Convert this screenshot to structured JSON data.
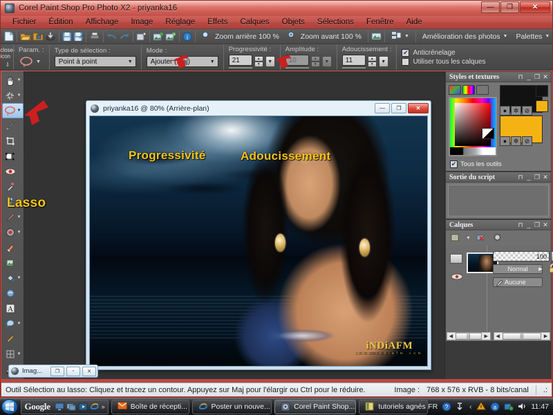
{
  "window": {
    "title": "Corel Paint Shop Pro Photo X2 - priyanka16",
    "icon": "application-icon",
    "buttons": {
      "minimize": "—",
      "maximize": "❐",
      "close": "✕"
    }
  },
  "menubar": {
    "items": [
      "Fichier",
      "Édition",
      "Affichage",
      "Image",
      "Réglage",
      "Effets",
      "Calques",
      "Objets",
      "Sélections",
      "Fenêtre",
      "Aide"
    ]
  },
  "toolbar": {
    "icons": [
      "new-file-icon",
      "open-folder-icon",
      "browse-icon",
      "download-icon",
      "save-icon",
      "save-as-icon",
      "print-icon",
      "undo-icon",
      "redo-icon",
      "screen-capture-icon",
      "import-image-icon",
      "export-image-icon",
      "info-icon"
    ],
    "zoom_out_label": "Zoom arrière 100 %",
    "zoom_in_label": "Zoom avant 100 %",
    "zoom_out_icon": "zoom-out-icon",
    "zoom_in_icon": "zoom-in-icon",
    "quick_fix_icon": "quick-fix-icon",
    "layout_icon": "layout-icon",
    "photo_enhance_label": "Amélioration des photos",
    "palettes_label": "Palettes",
    "overflow_label": "»"
  },
  "options_bar": {
    "param_label": "Param. :",
    "param_icon": "lasso-preset-icon",
    "selection_type_label": "Type de sélection :",
    "selection_type_value": "Point à point",
    "mode_label": "Mode :",
    "mode_value": "Ajouter (Maj)",
    "feather_label": "Progressivité :",
    "feather_value": "21",
    "range_label": "Amplitude :",
    "range_value": "10",
    "smoothing_label": "Adoucissement :",
    "smoothing_value": "11",
    "antialias_label": "Anticrénelage",
    "antialias_checked": "✔",
    "all_layers_label": "Utiliser tous les calques",
    "close_icon": "close-icon",
    "pin_icon": "pin-icon"
  },
  "tools_palette": {
    "items": [
      {
        "name": "pan-tool",
        "icon": "hand-icon",
        "has_flyout": true
      },
      {
        "name": "zoom-tool",
        "icon": "sparkle-icon",
        "has_flyout": true
      },
      {
        "name": "selection-lasso-tool",
        "icon": "lasso-icon",
        "has_flyout": true,
        "active": true
      },
      {
        "name": "dropper-tool",
        "icon": "eyedropper-icon",
        "has_flyout": false
      },
      {
        "name": "crop-tool",
        "icon": "crop-icon",
        "has_flyout": false
      },
      {
        "name": "move-tool",
        "icon": "move-icon",
        "has_flyout": false
      },
      {
        "name": "red-eye-tool",
        "icon": "red-eye-icon",
        "has_flyout": false
      },
      {
        "name": "makeover-tool",
        "icon": "makeover-icon",
        "has_flyout": false
      },
      {
        "name": "clone-brush-tool",
        "icon": "clone-brush-icon",
        "has_flyout": true
      },
      {
        "name": "paint-brush-tool",
        "icon": "paint-brush-icon",
        "has_flyout": true
      },
      {
        "name": "dodge-burn-tool",
        "icon": "dodge-icon",
        "has_flyout": true
      },
      {
        "name": "eraser-tool",
        "icon": "eraser-icon",
        "has_flyout": false
      },
      {
        "name": "picture-tube-tool",
        "icon": "picture-tube-icon",
        "has_flyout": false
      },
      {
        "name": "flood-fill-tool",
        "icon": "flood-fill-icon",
        "has_flyout": true
      },
      {
        "name": "warp-tool",
        "icon": "warp-icon",
        "has_flyout": false
      },
      {
        "name": "text-tool",
        "icon": "text-icon",
        "has_flyout": false
      },
      {
        "name": "preset-shape-tool",
        "icon": "shape-icon",
        "has_flyout": true
      },
      {
        "name": "pen-tool",
        "icon": "pen-icon",
        "has_flyout": false
      },
      {
        "name": "mesh-warp-tool",
        "icon": "mesh-warp-icon",
        "has_flyout": true
      },
      {
        "name": "vector-tool",
        "icon": "vector-icon",
        "has_flyout": true
      }
    ]
  },
  "document_window": {
    "title": "priyanka16 @  80% (Arrière-plan)",
    "icon": "document-icon",
    "buttons": {
      "minimize": "—",
      "maximize": "❐",
      "close": "✕"
    },
    "watermark": {
      "main": "iNDiAFM",
      "sub": "w w w . i n d i a f m . c o m"
    }
  },
  "minimized_window": {
    "title": "Imag...",
    "icon": "document-icon",
    "buttons": {
      "restore": "❐",
      "maximize": "▫",
      "close": "✕"
    }
  },
  "palettes": {
    "materials": {
      "title": "Styles et textures",
      "buttons": {
        "pin": "⊓",
        "minimize": "_",
        "maximize": "❐",
        "close": "✕"
      },
      "tabs": [
        "frame-tab",
        "rainbow-tab",
        "swatches-tab"
      ],
      "all_tools_label": "Tous les outils",
      "all_tools_checked": "✔",
      "foreground_color": "#121212",
      "background_color": "#f5b313"
    },
    "script_output": {
      "title": "Sortie du script",
      "buttons": {
        "pin": "⊓",
        "minimize": "_",
        "maximize": "❐",
        "close": "✕"
      },
      "content": ""
    },
    "layers": {
      "title": "Calques",
      "buttons": {
        "pin": "⊓",
        "minimize": "_",
        "maximize": "❐",
        "close": "✕"
      },
      "toolbar_icons": [
        "new-layer-icon",
        "delete-layer-icon",
        "layer-properties-icon"
      ],
      "rows": [
        {
          "thumb": "layer-thumbnail",
          "opacity": "100",
          "blend_mode": "Normal",
          "selection": "Aucune",
          "visibility_icon": "eye-icon",
          "lock_icon": "lock-icon",
          "brush_icon": "brush-icon"
        }
      ]
    }
  },
  "statusbar": {
    "hint": "Outil Sélection au lasso: Cliquez et tracez un contour. Appuyez sur Maj pour l'élargir ou Ctrl pour le réduire.",
    "image_label": "Image :",
    "image_info": "768 x 576 x RVB - 8 bits/canal",
    "resize_grip": ".:"
  },
  "annotations": [
    {
      "name": "feather-annotation",
      "text": "Progressivité",
      "color": "#f5c518"
    },
    {
      "name": "smoothing-annotation",
      "text": "Adoucissement",
      "color": "#f5c518"
    },
    {
      "name": "lasso-annotation",
      "text": "Lasso",
      "color": "#f5c518"
    }
  ],
  "arrow_color": "#cc1f1f",
  "taskbar": {
    "start_icon": "windows-start-icon",
    "quick_launch": {
      "google_label": "Google",
      "icons": [
        "show-desktop-icon",
        "switch-window-icon",
        "media-icon",
        "internet-explorer-icon"
      ],
      "overflow": "»"
    },
    "buttons": [
      {
        "name": "taskbar-item-mail",
        "label": "Boîte de récepti...",
        "icon": "mail-icon",
        "active": false
      },
      {
        "name": "taskbar-item-post",
        "label": "Poster un nouve...",
        "icon": "internet-explorer-icon",
        "active": false
      },
      {
        "name": "taskbar-item-corel",
        "label": "Corel Paint Shop...",
        "icon": "corel-icon",
        "active": true
      },
      {
        "name": "taskbar-item-folder",
        "label": "tutoriels agnés",
        "icon": "folder-icon",
        "active": false
      }
    ],
    "tray": {
      "language": "FR",
      "icons": [
        "help-icon",
        "update-icon",
        "chevron-left-icon",
        "warning-icon",
        "network-icon",
        "security-icon",
        "volume-icon"
      ],
      "clock": "11:47"
    }
  }
}
